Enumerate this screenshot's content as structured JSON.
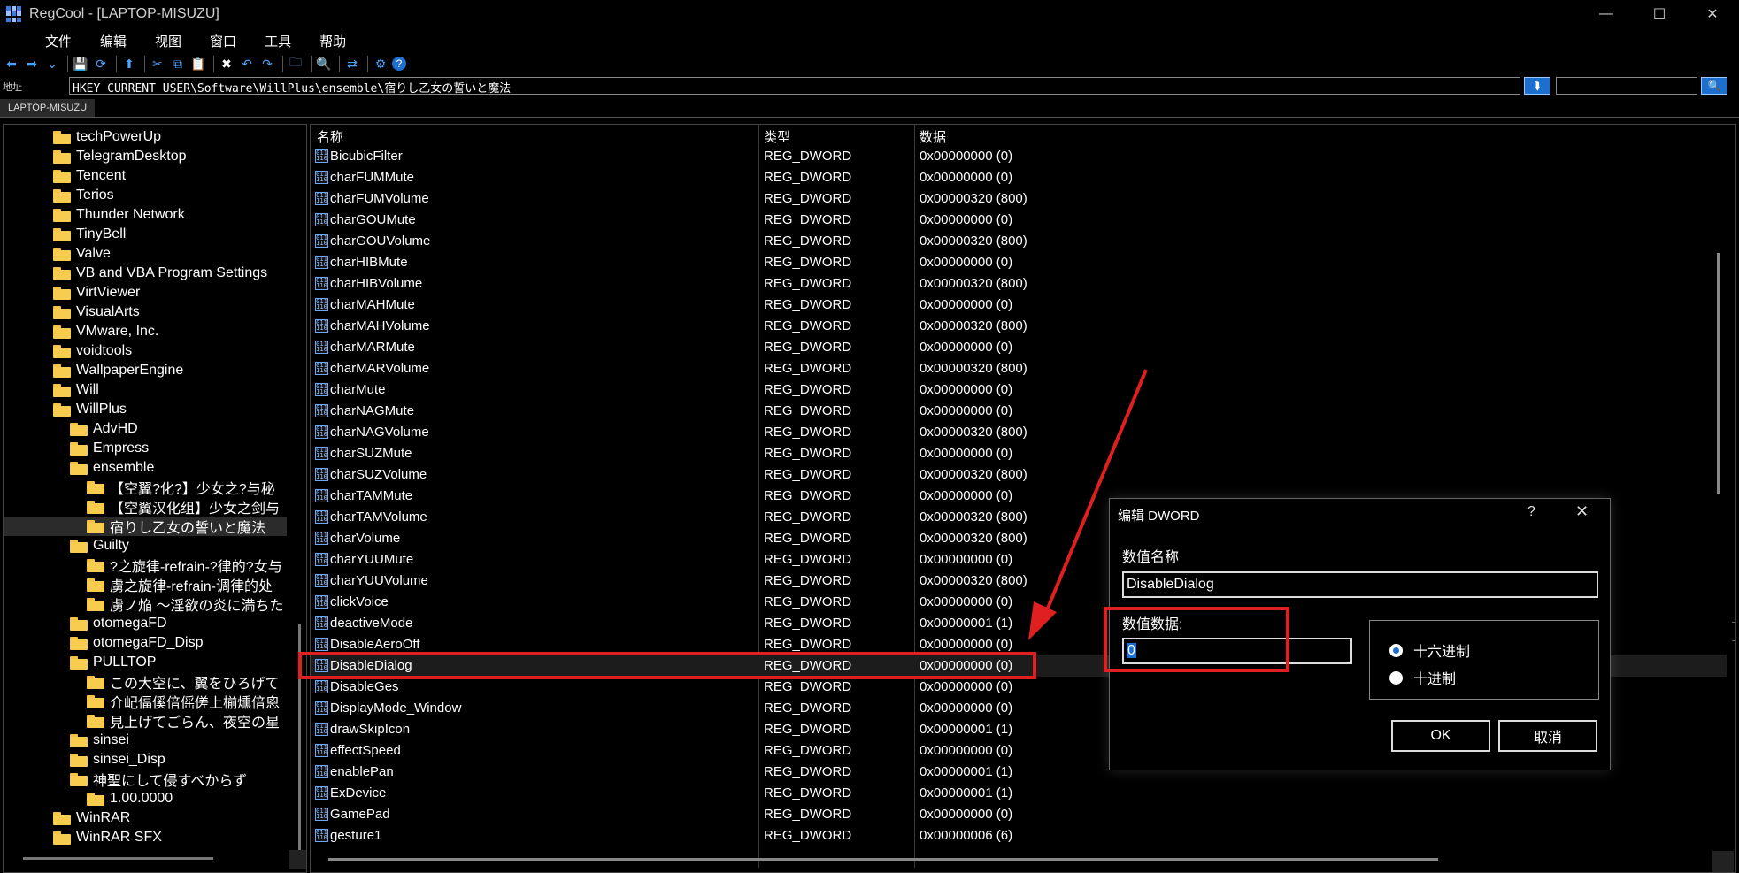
{
  "window": {
    "title": "RegCool - [LAPTOP-MISUZU]",
    "minimize": "—",
    "maximize": "☐",
    "close": "✕"
  },
  "menu": [
    "文件",
    "编辑",
    "视图",
    "窗口",
    "工具",
    "帮助"
  ],
  "toolbar": {
    "icons": [
      "back-icon",
      "forward-icon",
      "dropdown-icon",
      "sep",
      "save-icon",
      "refresh-icon",
      "sep",
      "up-icon",
      "sep",
      "cut-icon",
      "copy-icon",
      "paste-icon",
      "sep",
      "delete-icon",
      "undo-icon",
      "redo-icon",
      "sep",
      "new-key-icon",
      "sep",
      "find-icon",
      "sep",
      "compare-icon",
      "sep",
      "settings-icon",
      "help-icon"
    ]
  },
  "address": {
    "label": "地址",
    "path": "HKEY_CURRENT_USER\\Software\\WillPlus\\ensemble\\宿りし乙女の誓いと魔法"
  },
  "computer_tab": "LAPTOP-MISUZU",
  "tree": [
    {
      "label": "techPowerUp",
      "indent": 2
    },
    {
      "label": "TelegramDesktop",
      "indent": 2
    },
    {
      "label": "Tencent",
      "indent": 2
    },
    {
      "label": "Terios",
      "indent": 2
    },
    {
      "label": "Thunder Network",
      "indent": 2
    },
    {
      "label": "TinyBell",
      "indent": 2
    },
    {
      "label": "Valve",
      "indent": 2
    },
    {
      "label": "VB and VBA Program Settings",
      "indent": 2
    },
    {
      "label": "VirtViewer",
      "indent": 2
    },
    {
      "label": "VisualArts",
      "indent": 2
    },
    {
      "label": "VMware, Inc.",
      "indent": 2
    },
    {
      "label": "voidtools",
      "indent": 2
    },
    {
      "label": "WallpaperEngine",
      "indent": 2
    },
    {
      "label": "Will",
      "indent": 2
    },
    {
      "label": "WillPlus",
      "indent": 2
    },
    {
      "label": "AdvHD",
      "indent": 3
    },
    {
      "label": "Empress",
      "indent": 3
    },
    {
      "label": "ensemble",
      "indent": 3
    },
    {
      "label": "【空翼?化?】少女之?与秘",
      "indent": 4
    },
    {
      "label": "【空翼汉化组】少女之剑与",
      "indent": 4
    },
    {
      "label": "宿りし乙女の誓いと魔法",
      "indent": 4,
      "selected": true
    },
    {
      "label": "Guilty",
      "indent": 3
    },
    {
      "label": "?之旋律-refrain-?律的?女与",
      "indent": 4
    },
    {
      "label": "虜之旋律-refrain-调律的处",
      "indent": 4
    },
    {
      "label": "虜ノ焔 ～淫欲の炎に満ちた",
      "indent": 4
    },
    {
      "label": "otomegaFD",
      "indent": 3
    },
    {
      "label": "otomegaFD_Disp",
      "indent": 3
    },
    {
      "label": "PULLTOP",
      "indent": 3
    },
    {
      "label": "この大空に、翼をひろげて",
      "indent": 4
    },
    {
      "label": "介屺偪傒偣傜傞上椾燻偣恖",
      "indent": 4
    },
    {
      "label": "見上げてごらん、夜空の星",
      "indent": 4
    },
    {
      "label": "sinsei",
      "indent": 3
    },
    {
      "label": "sinsei_Disp",
      "indent": 3
    },
    {
      "label": "神聖にして侵すべからず",
      "indent": 3
    },
    {
      "label": "1.00.0000",
      "indent": 4
    },
    {
      "label": "WinRAR",
      "indent": 2
    },
    {
      "label": "WinRAR SFX",
      "indent": 2
    }
  ],
  "list": {
    "columns": [
      "名称",
      "类型",
      "数据"
    ],
    "rows": [
      [
        "BicubicFilter",
        "REG_DWORD",
        "0x00000000 (0)"
      ],
      [
        "charFUMMute",
        "REG_DWORD",
        "0x00000000 (0)"
      ],
      [
        "charFUMVolume",
        "REG_DWORD",
        "0x00000320 (800)"
      ],
      [
        "charGOUMute",
        "REG_DWORD",
        "0x00000000 (0)"
      ],
      [
        "charGOUVolume",
        "REG_DWORD",
        "0x00000320 (800)"
      ],
      [
        "charHIBMute",
        "REG_DWORD",
        "0x00000000 (0)"
      ],
      [
        "charHIBVolume",
        "REG_DWORD",
        "0x00000320 (800)"
      ],
      [
        "charMAHMute",
        "REG_DWORD",
        "0x00000000 (0)"
      ],
      [
        "charMAHVolume",
        "REG_DWORD",
        "0x00000320 (800)"
      ],
      [
        "charMARMute",
        "REG_DWORD",
        "0x00000000 (0)"
      ],
      [
        "charMARVolume",
        "REG_DWORD",
        "0x00000320 (800)"
      ],
      [
        "charMute",
        "REG_DWORD",
        "0x00000000 (0)"
      ],
      [
        "charNAGMute",
        "REG_DWORD",
        "0x00000000 (0)"
      ],
      [
        "charNAGVolume",
        "REG_DWORD",
        "0x00000320 (800)"
      ],
      [
        "charSUZMute",
        "REG_DWORD",
        "0x00000000 (0)"
      ],
      [
        "charSUZVolume",
        "REG_DWORD",
        "0x00000320 (800)"
      ],
      [
        "charTAMMute",
        "REG_DWORD",
        "0x00000000 (0)"
      ],
      [
        "charTAMVolume",
        "REG_DWORD",
        "0x00000320 (800)"
      ],
      [
        "charVolume",
        "REG_DWORD",
        "0x00000320 (800)"
      ],
      [
        "charYUUMute",
        "REG_DWORD",
        "0x00000000 (0)"
      ],
      [
        "charYUUVolume",
        "REG_DWORD",
        "0x00000320 (800)"
      ],
      [
        "clickVoice",
        "REG_DWORD",
        "0x00000000 (0)"
      ],
      [
        "deactiveMode",
        "REG_DWORD",
        "0x00000001 (1)"
      ],
      [
        "DisableAeroOff",
        "REG_DWORD",
        "0x00000000 (0)"
      ],
      [
        "DisableDialog",
        "REG_DWORD",
        "0x00000000 (0)"
      ],
      [
        "DisableGes",
        "REG_DWORD",
        "0x00000000 (0)"
      ],
      [
        "DisplayMode_Window",
        "REG_DWORD",
        "0x00000000 (0)"
      ],
      [
        "drawSkipIcon",
        "REG_DWORD",
        "0x00000001 (1)"
      ],
      [
        "effectSpeed",
        "REG_DWORD",
        "0x00000000 (0)"
      ],
      [
        "enablePan",
        "REG_DWORD",
        "0x00000001 (1)"
      ],
      [
        "ExDevice",
        "REG_DWORD",
        "0x00000001 (1)"
      ],
      [
        "GamePad",
        "REG_DWORD",
        "0x00000000 (0)"
      ],
      [
        "gesture1",
        "REG_DWORD",
        "0x00000006 (6)"
      ]
    ],
    "selected_row": 24
  },
  "dialog": {
    "title": "编辑 DWORD",
    "help": "?",
    "close": "✕",
    "name_label": "数值名称",
    "name_value": "DisableDialog",
    "data_label": "数值数据:",
    "data_value": "0",
    "radix_hex": "十六进制",
    "radix_dec": "十进制",
    "radix_selected": "hex",
    "ok": "OK",
    "cancel": "取消"
  },
  "annotation_color": "#e02020"
}
